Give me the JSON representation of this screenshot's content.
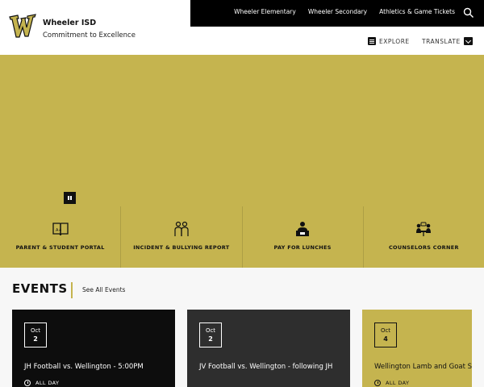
{
  "header": {
    "brand_name": "Wheeler ISD",
    "tagline": "Commitment to Excellence",
    "top_nav": [
      "Wheeler Elementary",
      "Wheeler Secondary",
      "Athletics & Game Tickets"
    ],
    "explore_label": "EXPLORE",
    "translate_label": "TRANSLATE"
  },
  "quick_links": [
    {
      "label": "PARENT & STUDENT PORTAL",
      "icon": "book-icon"
    },
    {
      "label": "INCIDENT & BULLYING REPORT",
      "icon": "people-icon"
    },
    {
      "label": "PAY FOR LUNCHES",
      "icon": "lunch-icon"
    },
    {
      "label": "COUNSELORS CORNER",
      "icon": "counselor-icon"
    }
  ],
  "events": {
    "title": "EVENTS",
    "see_all": "See All Events",
    "items": [
      {
        "month": "Oct",
        "day": "2",
        "title": "JH Football vs. Wellington - 5:00PM",
        "meta": "ALL DAY"
      },
      {
        "month": "Oct",
        "day": "2",
        "title": "JV Football vs. Wellington - following JH",
        "meta": ""
      },
      {
        "month": "Oct",
        "day": "4",
        "title": "Wellington Lamb and Goat Show",
        "meta": "ALL DAY"
      }
    ]
  },
  "colors": {
    "gold": "#c5b44f",
    "black": "#000000"
  }
}
